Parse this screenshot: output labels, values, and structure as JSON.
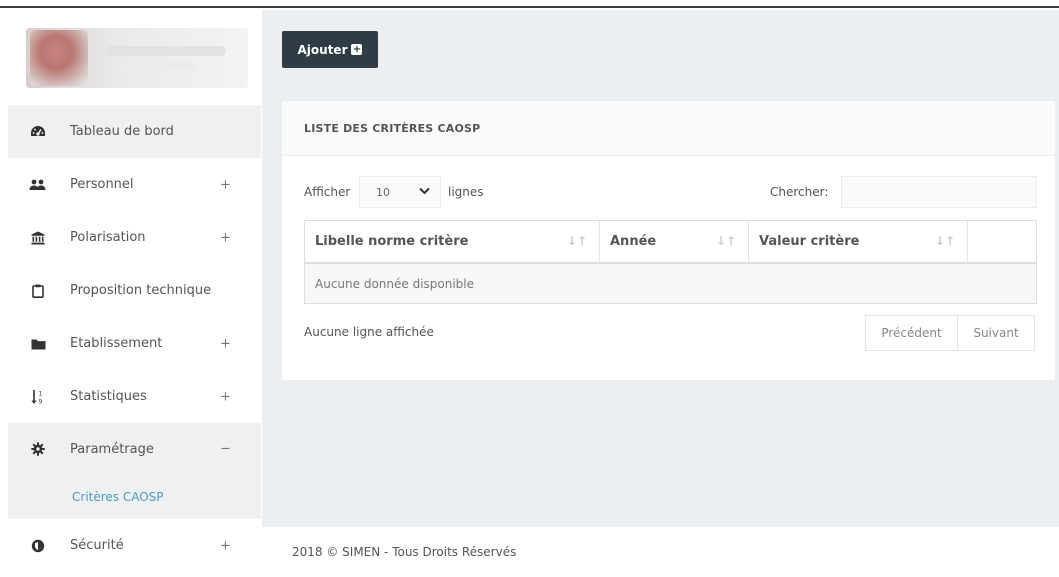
{
  "sidebar": {
    "items": [
      {
        "label": "Tableau de bord",
        "icon": "dashboard-icon",
        "toggle": ""
      },
      {
        "label": "Personnel",
        "icon": "users-icon",
        "toggle": "+"
      },
      {
        "label": "Polarisation",
        "icon": "bank-icon",
        "toggle": "+"
      },
      {
        "label": "Proposition technique",
        "icon": "clipboard-icon",
        "toggle": ""
      },
      {
        "label": "Etablissement",
        "icon": "folder-icon",
        "toggle": "+"
      },
      {
        "label": "Statistiques",
        "icon": "sort-numeric-icon",
        "toggle": "+"
      },
      {
        "label": "Paramétrage",
        "icon": "gear-icon",
        "toggle": "−"
      },
      {
        "label": "Sécurité",
        "icon": "shield-icon",
        "toggle": "+"
      }
    ],
    "submenu": {
      "label": "Critères CAOSP"
    }
  },
  "toolbar": {
    "add_label": "Ajouter",
    "add_icon": "plus-square-icon"
  },
  "panel": {
    "title": "LISTE DES CRITÈRES CAOSP",
    "show_label": "Afficher",
    "page_size": "10",
    "lines_label": "lignes",
    "search_label": "Chercher:",
    "search_value": "",
    "columns": [
      "Libelle norme critère",
      "Année",
      "Valeur critère",
      ""
    ],
    "empty_text": "Aucune donnée disponible",
    "info_text": "Aucune ligne affichée",
    "prev_label": "Précédent",
    "next_label": "Suivant"
  },
  "footer": {
    "text": "2018 © SIMEN - Tous Droits Réservés"
  },
  "colors": {
    "accent_dark": "#2f3b45",
    "link_blue": "#4a9bc6",
    "content_bg": "#eceff1"
  }
}
